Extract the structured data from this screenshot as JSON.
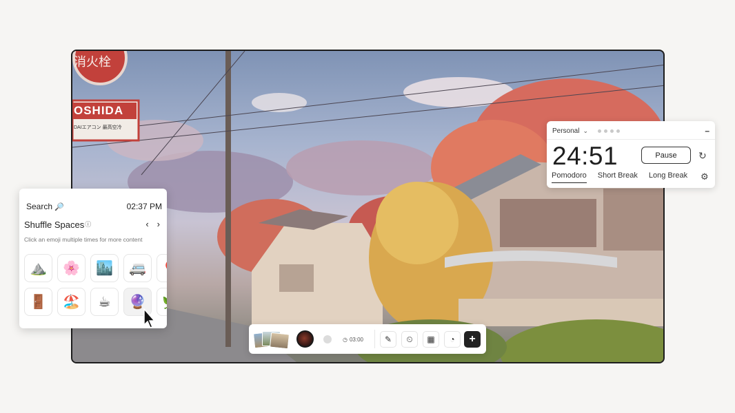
{
  "timer": {
    "workspace": "Personal",
    "time": "24:51",
    "pause_label": "Pause",
    "tabs": [
      "Pomodoro",
      "Short Break",
      "Long Break"
    ],
    "active_tab": "Pomodoro"
  },
  "panel": {
    "search_label": "Search",
    "clock": "02:37 PM",
    "title": "Shuffle Spaces",
    "hint": "Click an emoji multiple times for more content",
    "emojis_row1": [
      "⛰️",
      "🌸",
      "🏙️",
      "🚐",
      "🎈"
    ],
    "emojis_row2": [
      "🚪",
      "🏖️",
      "☕",
      "🔮",
      "🌿"
    ]
  },
  "scene": {
    "sign_text": "OSHIDA",
    "sign_sub": "DAIエアコン 最高空冷",
    "sign_top": "消火栓"
  },
  "toolbar": {
    "timer_text": "03:00"
  },
  "icons": {
    "collapse": "minus-icon",
    "reset": "refresh-icon",
    "settings": "gear-icon",
    "info": "info-icon",
    "prev": "chevron-left-icon",
    "next": "chevron-right-icon",
    "add": "plus-icon"
  }
}
